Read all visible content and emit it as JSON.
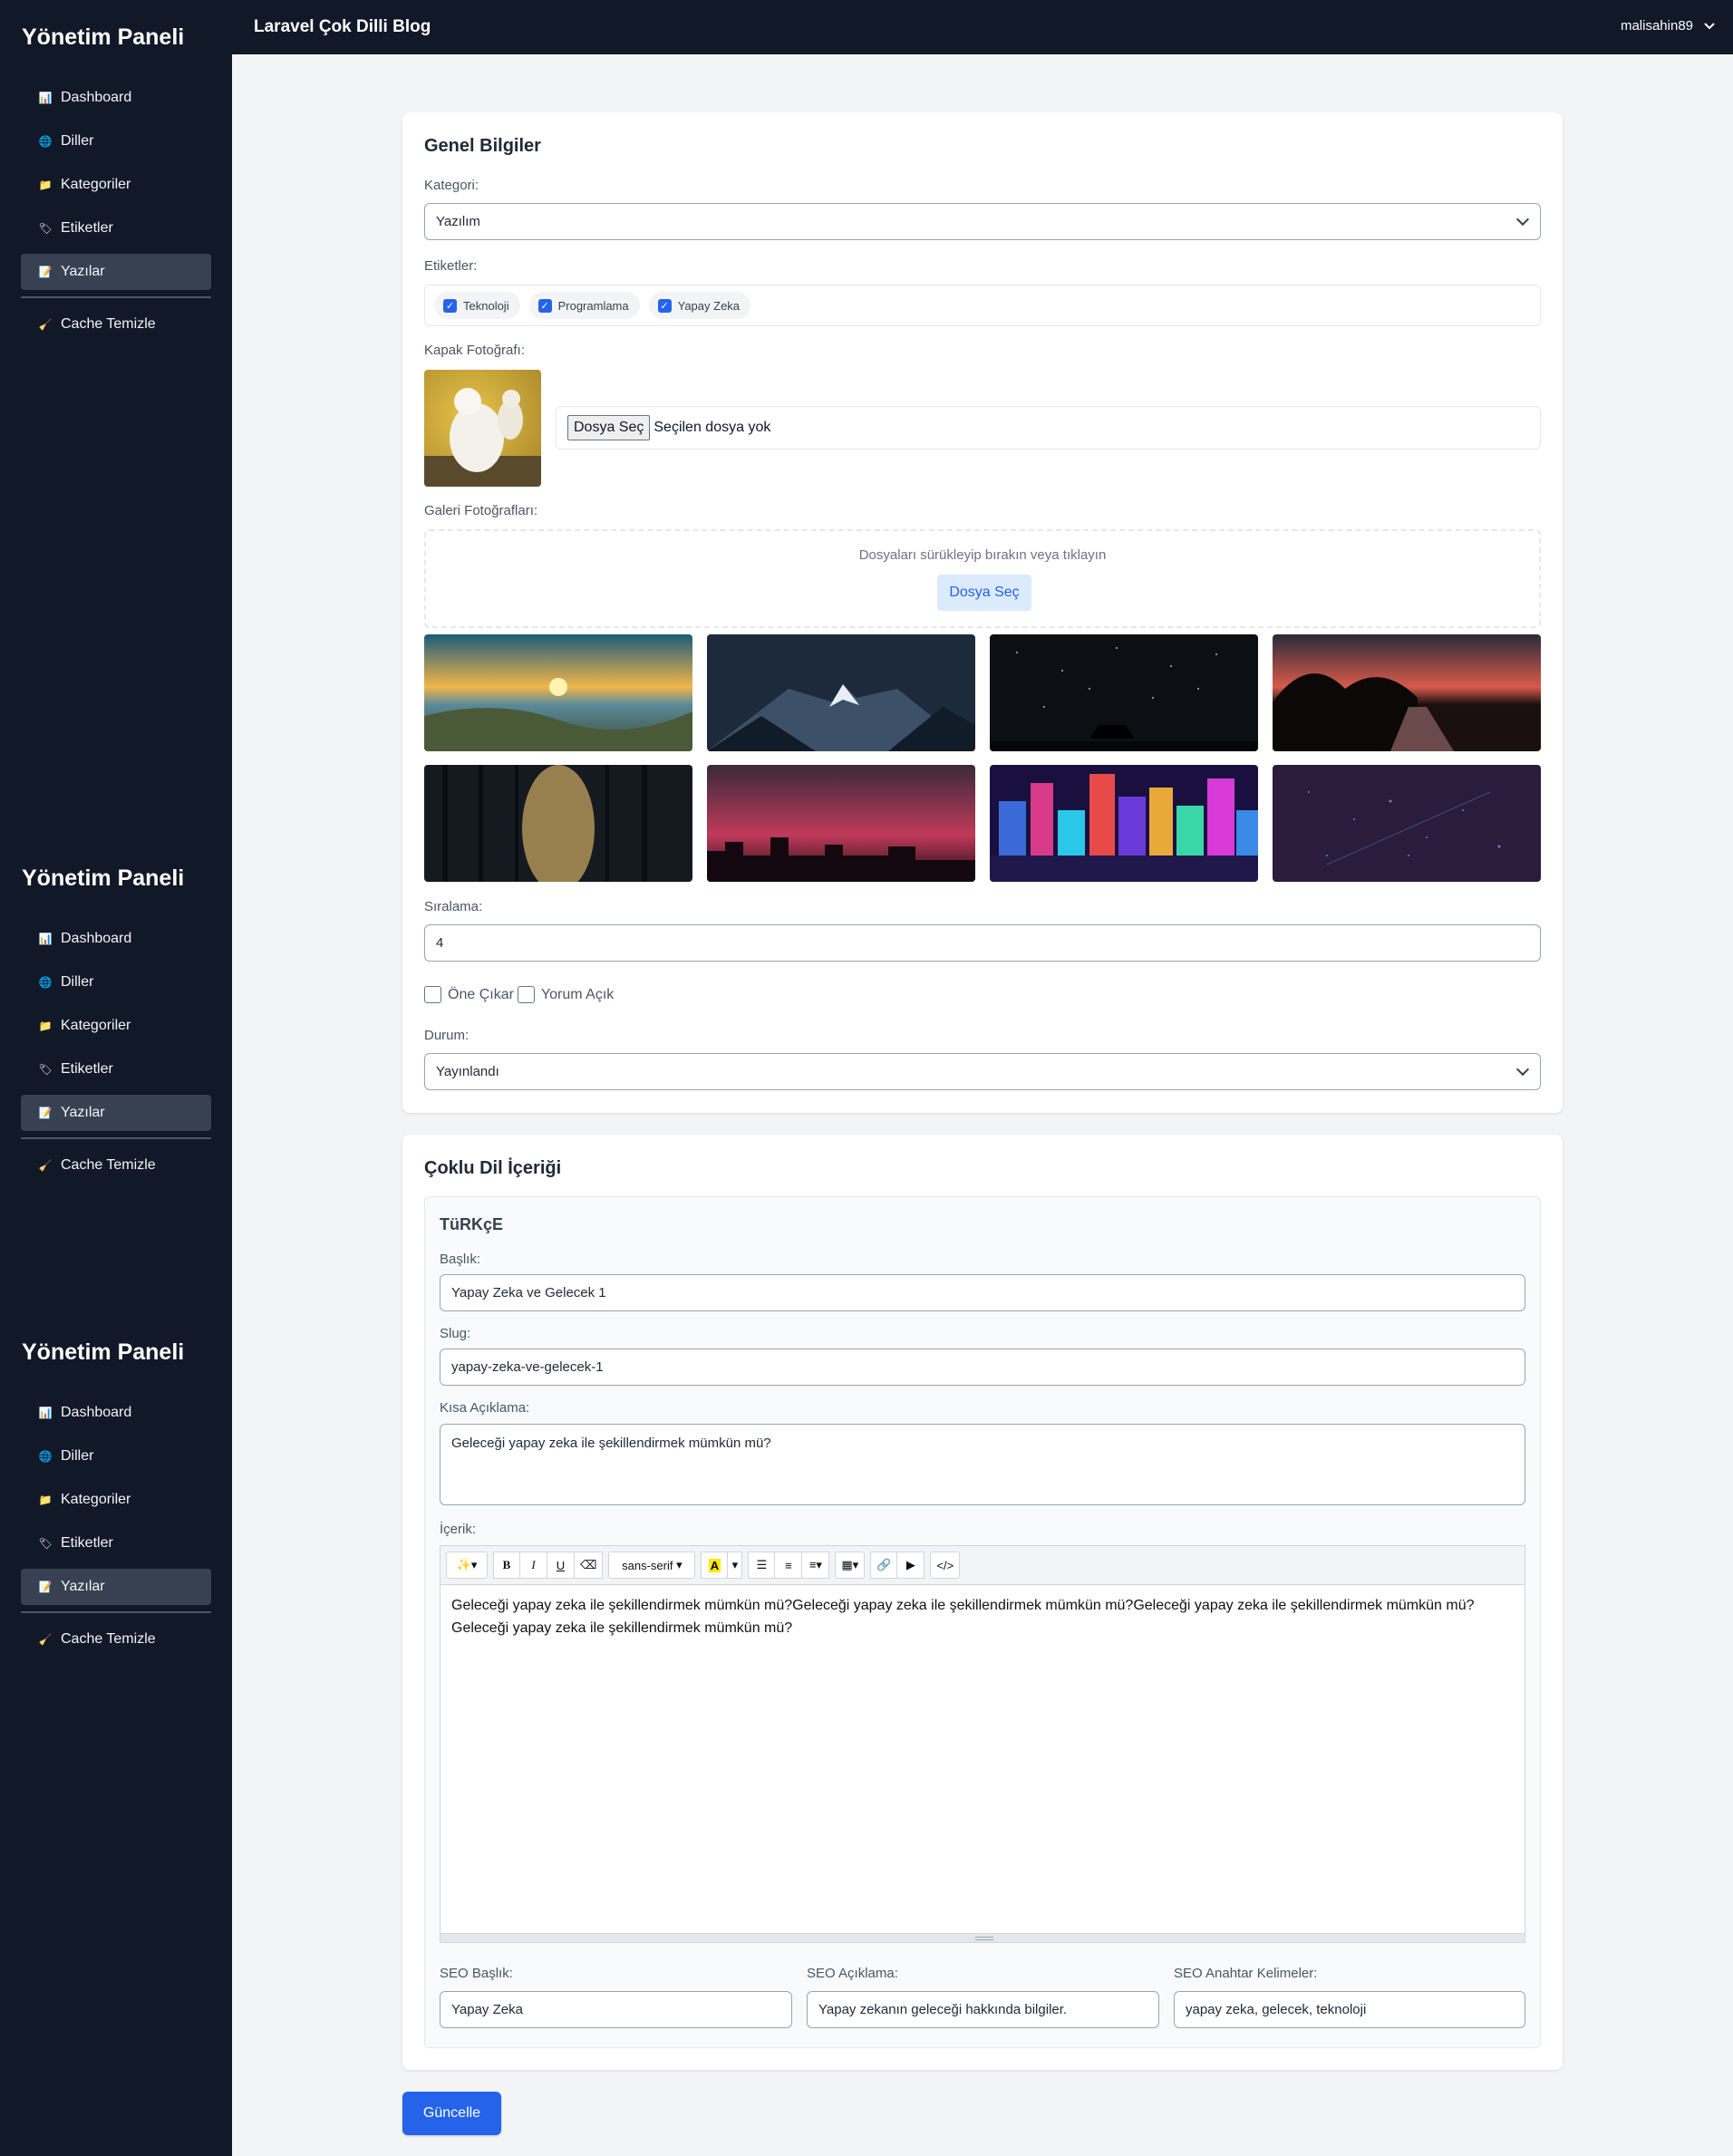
{
  "sidebar": {
    "title": "Yönetim Paneli",
    "items": [
      {
        "label": "Dashboard",
        "icon": "bar-chart-icon"
      },
      {
        "label": "Diller",
        "icon": "globe-icon"
      },
      {
        "label": "Kategoriler",
        "icon": "folder-icon"
      },
      {
        "label": "Etiketler",
        "icon": "tag-icon"
      },
      {
        "label": "Yazılar",
        "icon": "document-icon",
        "active": true
      }
    ],
    "cache_label": "Cache Temizle"
  },
  "header": {
    "app_title": "Laravel Çok Dilli Blog",
    "user": "malisahin89"
  },
  "general": {
    "title": "Genel Bilgiler",
    "category_label": "Kategori:",
    "category_value": "Yazılım",
    "tags_label": "Etiketler:",
    "tags": [
      "Teknoloji",
      "Programlama",
      "Yapay Zeka"
    ],
    "cover_label": "Kapak Fotoğrafı:",
    "file_button": "Dosya Seç",
    "file_status": "Seçilen dosya yok",
    "gallery_label": "Galeri Fotoğrafları:",
    "dropzone_text": "Dosyaları sürükleyip bırakın veya tıklayın",
    "dropzone_button": "Dosya Seç",
    "gallery_images": [
      "sunset-mountain",
      "snowy-peak-night",
      "starry-sky-truck",
      "dusk-road",
      "forest-light-path",
      "city-skyline-red",
      "neon-city",
      "starfield-purple"
    ],
    "order_label": "Sıralama:",
    "order_value": "4",
    "featured_label": "Öne Çıkar",
    "comments_label": "Yorum Açık",
    "status_label": "Durum:",
    "status_value": "Yayınlandı"
  },
  "multilang": {
    "title": "Çoklu Dil İçeriği",
    "language": "TüRKçE",
    "title_label": "Başlık:",
    "title_value": "Yapay Zeka ve Gelecek 1",
    "slug_label": "Slug:",
    "slug_value": "yapay-zeka-ve-gelecek-1",
    "summary_label": "Kısa Açıklama:",
    "summary_value": "Geleceği yapay zeka ile şekillendirmek mümkün mü?",
    "content_label": "İçerik:",
    "font_select": "sans-serif",
    "content_line1": "Geleceği yapay zeka ile şekillendirmek mümkün mü?Geleceği yapay zeka ile şekillendirmek mümkün mü?Geleceği yapay zeka ile şekillendirmek mümkün mü?",
    "content_line2": "Geleceği yapay zeka ile şekillendirmek mümkün mü?",
    "seo_title_label": "SEO Başlık:",
    "seo_title_value": "Yapay Zeka",
    "seo_desc_label": "SEO Açıklama:",
    "seo_desc_value": "Yapay zekanın geleceği hakkında bilgiler.",
    "seo_keywords_label": "SEO Anahtar Kelimeler:",
    "seo_keywords_value": "yapay zeka, gelecek, teknoloji"
  },
  "actions": {
    "update_label": "Güncelle"
  },
  "colors": {
    "sidebar_bg": "#111827",
    "primary": "#2563eb"
  }
}
